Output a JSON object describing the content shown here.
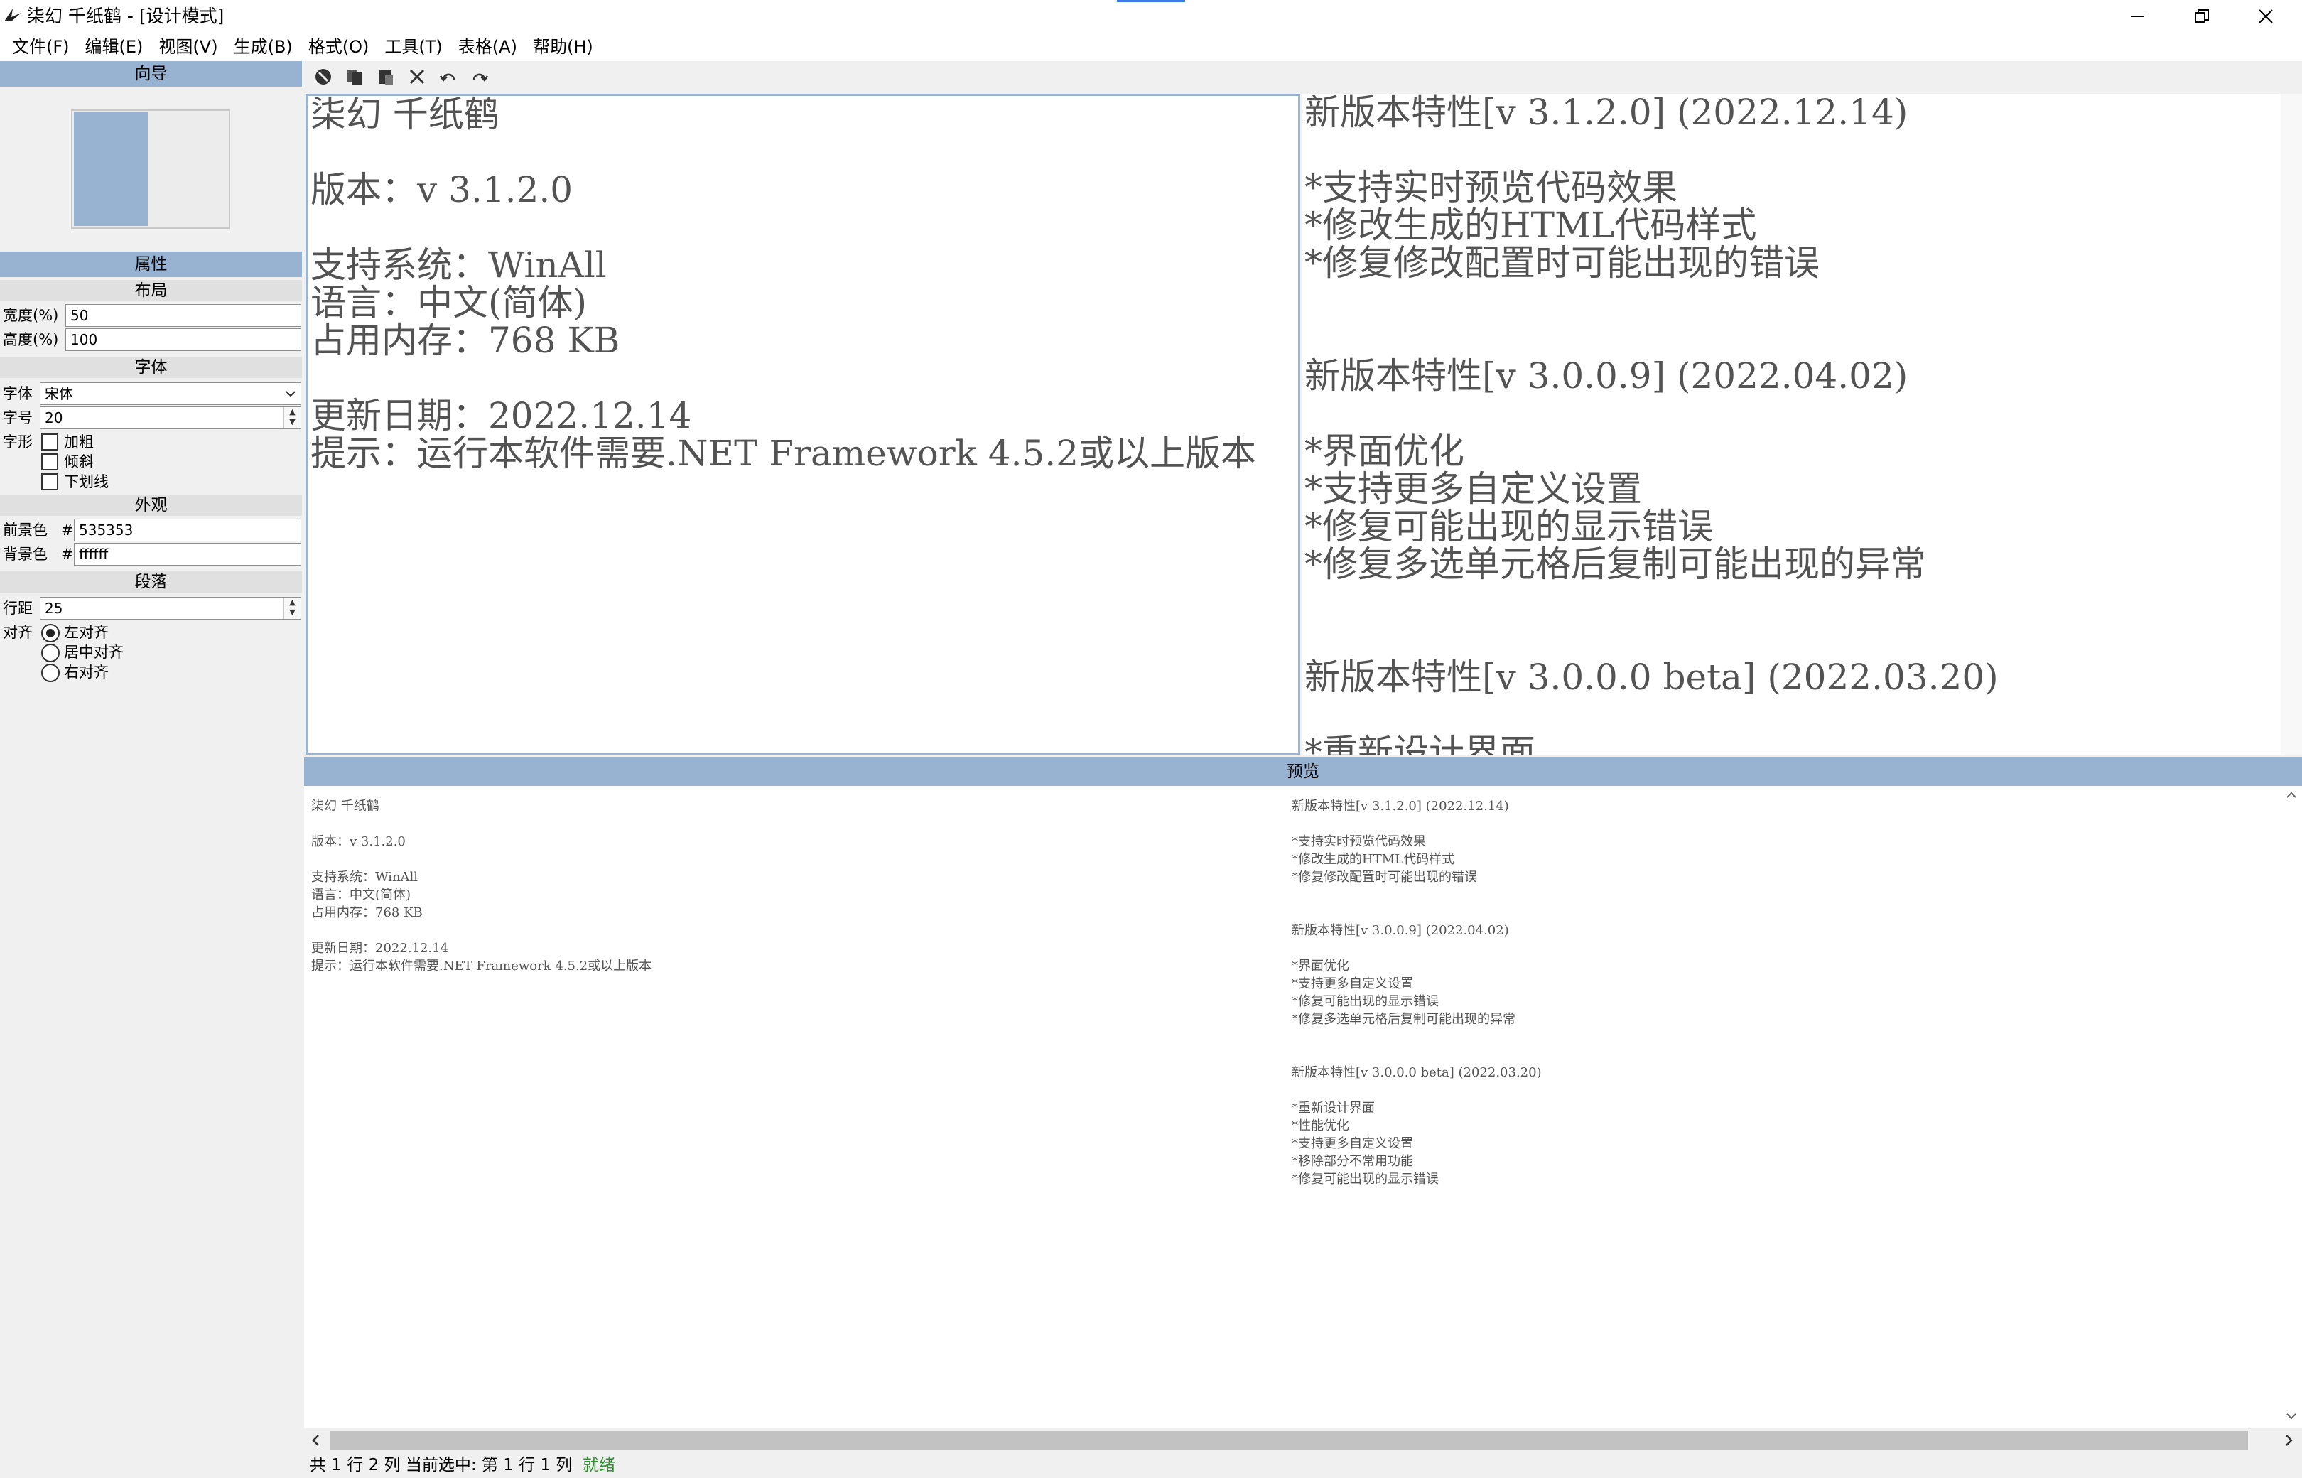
{
  "window": {
    "title": "柒幻 千纸鹤 - [设计模式]",
    "controls": {
      "minimize": "—",
      "maximize": "❐",
      "close": "✕"
    }
  },
  "menu": [
    "文件(F)",
    "编辑(E)",
    "视图(V)",
    "生成(B)",
    "格式(O)",
    "工具(T)",
    "表格(A)",
    "帮助(H)"
  ],
  "left_panel": {
    "wizard_title": "向导",
    "properties_title": "属性",
    "layout": {
      "heading": "布局",
      "width_label": "宽度(%)",
      "width_value": "50",
      "height_label": "高度(%)",
      "height_value": "100"
    },
    "font": {
      "heading": "字体",
      "family_label": "字体",
      "family_value": "宋体",
      "size_label": "字号",
      "size_value": "20",
      "style_label": "字形",
      "bold": "加粗",
      "italic": "倾斜",
      "underline": "下划线"
    },
    "appearance": {
      "heading": "外观",
      "fg_label": "前景色",
      "fg_hash": "#",
      "fg_value": "535353",
      "bg_label": "背景色",
      "bg_hash": "#",
      "bg_value": "ffffff"
    },
    "paragraph": {
      "heading": "段落",
      "spacing_label": "行距",
      "spacing_value": "25",
      "align_label": "对齐",
      "align_left": "左对齐",
      "align_center": "居中对齐",
      "align_right": "右对齐",
      "selected_align": "左对齐"
    }
  },
  "editor": {
    "left_cell": "柒幻 千纸鹤\n\n版本：v 3.1.2.0\n\n支持系统：WinAll\n语言：中文(简体)\n占用内存：768 KB\n\n更新日期：2022.12.14\n提示：运行本软件需要.NET Framework 4.5.2或以上版本",
    "right_cell": "新版本特性[v 3.1.2.0] (2022.12.14)\n\n*支持实时预览代码效果\n*修改生成的HTML代码样式\n*修复修改配置时可能出现的错误\n\n\n新版本特性[v 3.0.0.9] (2022.04.02)\n\n*界面优化\n*支持更多自定义设置\n*修复可能出现的显示错误\n*修复多选单元格后复制可能出现的异常\n\n\n新版本特性[v 3.0.0.0 beta] (2022.03.20)\n\n*重新设计界面"
  },
  "preview": {
    "title": "预览",
    "left_text": "柒幻 千纸鹤\n\n版本：v 3.1.2.0\n\n支持系统：WinAll\n语言：中文(简体)\n占用内存：768 KB\n\n更新日期：2022.12.14\n提示：运行本软件需要.NET Framework 4.5.2或以上版本",
    "right_text": "新版本特性[v 3.1.2.0] (2022.12.14)\n\n*支持实时预览代码效果\n*修改生成的HTML代码样式\n*修复修改配置时可能出现的错误\n\n\n新版本特性[v 3.0.0.9] (2022.04.02)\n\n*界面优化\n*支持更多自定义设置\n*修复可能出现的显示错误\n*修复多选单元格后复制可能出现的异常\n\n\n新版本特性[v 3.0.0.0 beta] (2022.03.20)\n\n*重新设计界面\n*性能优化\n*支持更多自定义设置\n*移除部分不常用功能\n*修复可能出现的显示错误"
  },
  "status": {
    "info": "共 1 行 2 列 当前选中: 第 1 行 1 列",
    "state": "就绪"
  },
  "colors": {
    "accent": "#98b2d2",
    "text": "#535353",
    "ready": "#2f8f2f"
  },
  "icons": [
    "app-icon",
    "new-table-icon",
    "copy-icon",
    "paste-icon",
    "delete-icon",
    "undo-icon",
    "redo-icon"
  ]
}
